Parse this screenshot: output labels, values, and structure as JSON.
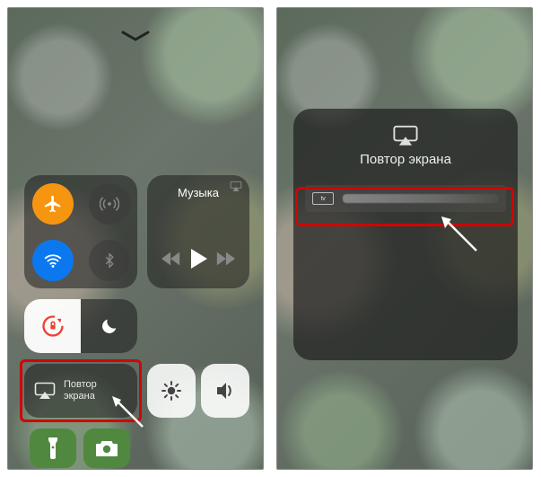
{
  "left_screen": {
    "handle_icon": "chevron-down",
    "connectivity": {
      "airplane": {
        "icon": "airplane",
        "on": true,
        "accent": "#ff9500"
      },
      "cellular": {
        "icon": "antenna",
        "on": false
      },
      "wifi": {
        "icon": "wifi",
        "on": true,
        "accent": "#007aff"
      },
      "bluetooth": {
        "icon": "bluetooth",
        "on": false
      }
    },
    "music": {
      "title": "Музыка",
      "prev_icon": "backward",
      "play_icon": "play",
      "next_icon": "forward",
      "airplay_corner_icon": "airplay"
    },
    "orientation_lock": {
      "icon": "rotation-lock",
      "locked": true,
      "accent": "#ff3b30"
    },
    "do_not_disturb": {
      "icon": "moon",
      "on": false
    },
    "screen_mirroring_tile": {
      "icon": "screen-mirror",
      "label": "Повтор\nэкрана"
    },
    "brightness": {
      "icon": "sun"
    },
    "volume": {
      "icon": "speaker"
    },
    "flashlight": {
      "icon": "flashlight",
      "accent": "#4c8a3a"
    },
    "camera": {
      "icon": "camera",
      "accent": "#4c8a3a"
    }
  },
  "right_screen": {
    "panel": {
      "header_icon": "screen-mirror",
      "title": "Повтор экрана",
      "device": {
        "badge_text": "tv",
        "name_obscured": true
      }
    }
  },
  "annotations": {
    "left_highlight_color": "#e20000",
    "right_highlight_color": "#e20000",
    "arrow_color": "#ffffff"
  }
}
